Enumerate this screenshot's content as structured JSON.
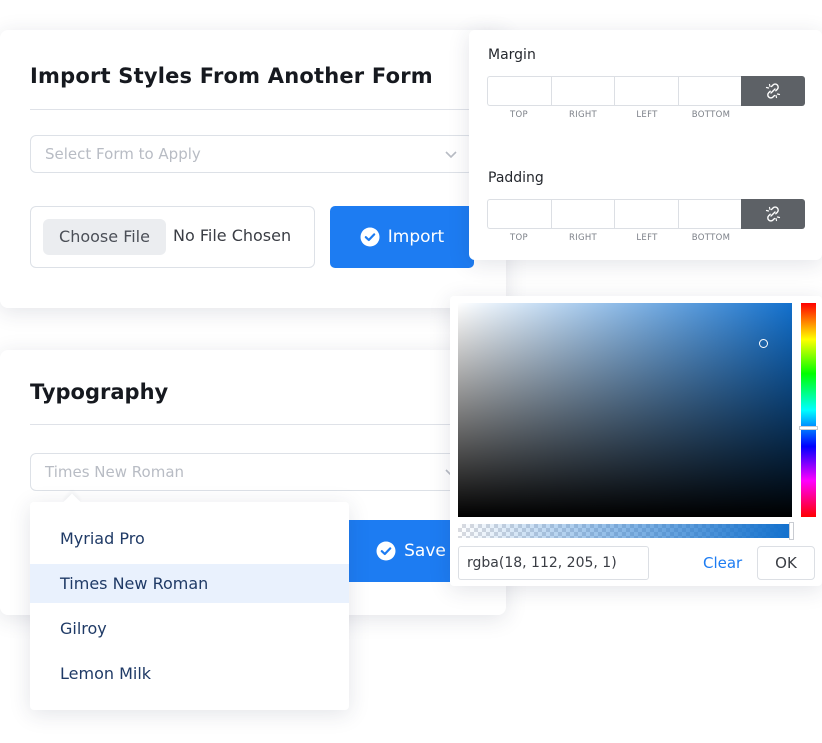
{
  "import_section": {
    "title": "Import Styles From Another Form",
    "form_select_placeholder": "Select Form to Apply",
    "choose_file_label": "Choose File",
    "file_status": "No File Chosen",
    "import_label": "Import"
  },
  "typography_section": {
    "title": "Typography",
    "font_select_value": "Times New Roman",
    "save_label": "Save",
    "dropdown_options": [
      "Myriad Pro",
      "Times New Roman",
      "Gilroy",
      "Lemon Milk"
    ],
    "selected_option": "Times New Roman"
  },
  "spacing": {
    "margin_label": "Margin",
    "padding_label": "Padding",
    "sides": [
      "TOP",
      "RIGHT",
      "LEFT",
      "BOTTOM"
    ]
  },
  "color_picker": {
    "value": "rgba(18, 112, 205, 1)",
    "clear_label": "Clear",
    "ok_label": "OK",
    "hue_color": "#1270cd"
  },
  "icons": {
    "check": "check-circle-icon",
    "chevron": "chevron-down-icon",
    "link": "unlink-icon"
  },
  "colors": {
    "primary": "#1d7cf2",
    "link_button": "#5d6166",
    "dropdown_text": "#1f3a66",
    "dropdown_active_bg": "#e9f1fd"
  }
}
